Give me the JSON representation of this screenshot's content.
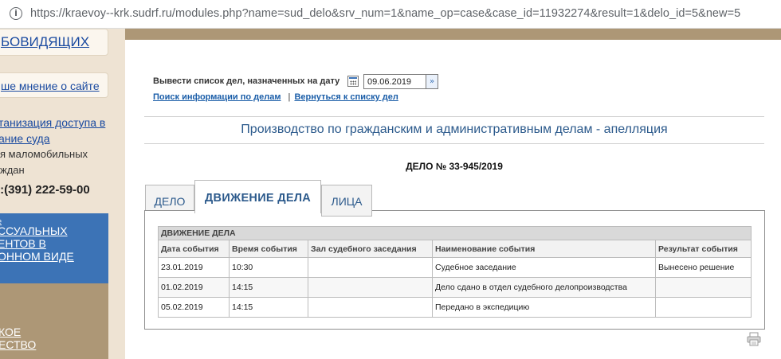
{
  "browser": {
    "url_scheme": "https://",
    "url_rest": "kraevoy--krk.sudrf.ru/modules.php?name=sud_delo&srv_num=1&name_op=case&case_id=11932274&result=1&delo_id=5&new=5",
    "info_icon": "info-icon"
  },
  "sidebar": {
    "link1": "БОВИДЯЩИХ",
    "link2": "ше мнение о сайте",
    "access_link_line1": "танизация доступа в",
    "access_link_line2": "ание суда",
    "access_text1": "я маломобильных",
    "access_text2": "ждан",
    "phone": ".:(391) 222-59-00",
    "blue_line0": "е",
    "blue_line1": "ССУАЛЬНЫХ",
    "blue_line2": "ЕНТОВ В",
    "blue_line3": "ОННОМ ВИДЕ",
    "brown_line1": "КОЕ",
    "brown_line2": "ЕСТВО"
  },
  "search": {
    "date_label": "Вывести список дел, назначенных на дату",
    "date_value": "09.06.2019",
    "link_search": "Поиск информации по делам",
    "separator": "|",
    "link_back": "Вернуться к списку дел"
  },
  "section_title": "Производство по гражданским и административным делам - апелляция",
  "case_number": "ДЕЛО № 33-945/2019",
  "tabs": [
    {
      "label": "ДЕЛО",
      "active": false
    },
    {
      "label": "ДВИЖЕНИЕ ДЕЛА",
      "active": true
    },
    {
      "label": "ЛИЦА",
      "active": false
    }
  ],
  "movement": {
    "caption": "ДВИЖЕНИЕ ДЕЛА",
    "columns": [
      "Дата события",
      "Время события",
      "Зал судебного заседания",
      "Наименование события",
      "Результат события"
    ],
    "rows": [
      [
        "23.01.2019",
        "10:30",
        "",
        "Судебное заседание",
        "Вынесено решение"
      ],
      [
        "01.02.2019",
        "14:15",
        "",
        "Дело сдано в отдел судебного делопроизводства",
        ""
      ],
      [
        "05.02.2019",
        "14:15",
        "",
        "Передано в экспедицию",
        ""
      ]
    ]
  },
  "icons": {
    "calendar": "calendar-icon",
    "go": "go-arrow-icon",
    "print": "print-icon"
  }
}
